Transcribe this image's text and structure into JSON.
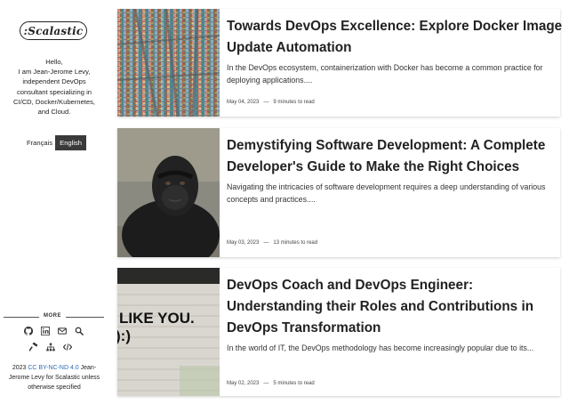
{
  "sidebar": {
    "logo": ":Scalastic",
    "bio_lines": [
      "Hello,",
      "I am Jean-Jerome Levy,",
      "independent DevOps",
      "consultant specializing in",
      "CI/CD, Docker/Kubernetes,",
      "and Cloud."
    ],
    "lang_fr": "Français",
    "lang_en": "English",
    "more_label": "MORE",
    "icons": [
      "github-icon",
      "linkedin-icon",
      "email-icon",
      "search-icon",
      "hammer-icon",
      "sitemap-icon",
      "code-icon"
    ],
    "footer_year": "2023",
    "footer_license": "CC BY-NC-ND 4.0",
    "footer_rest": "Jean-Jerome Levy for Scalastic unless otherwise specified"
  },
  "posts": [
    {
      "title": "Towards DevOps Excellence: Explore Docker Image Update Automation",
      "excerpt": "In the DevOps ecosystem, containerization with Docker has become a common practice for deploying applications....",
      "date": "May 04, 2023",
      "sep": "—",
      "read_time": "9 minutes to read"
    },
    {
      "title": "Demystifying Software Development: A Complete Developer's Guide to Make the Right Choices",
      "excerpt": "Navigating the intricacies of software development requires a deep understanding of various concepts and practices....",
      "date": "May 03, 2023",
      "sep": "—",
      "read_time": "13 minutes to read"
    },
    {
      "title": "DevOps Coach and DevOps Engineer: Understanding their Roles and Contributions in DevOps Transformation",
      "excerpt": "In the world of IT, the DevOps methodology has become increasingly popular due to its...",
      "date": "May 02, 2023",
      "sep": "—",
      "read_time": "5 minutes to read",
      "thumb_text_1": "LIKE YOU.",
      "thumb_text_2": "):)"
    }
  ]
}
